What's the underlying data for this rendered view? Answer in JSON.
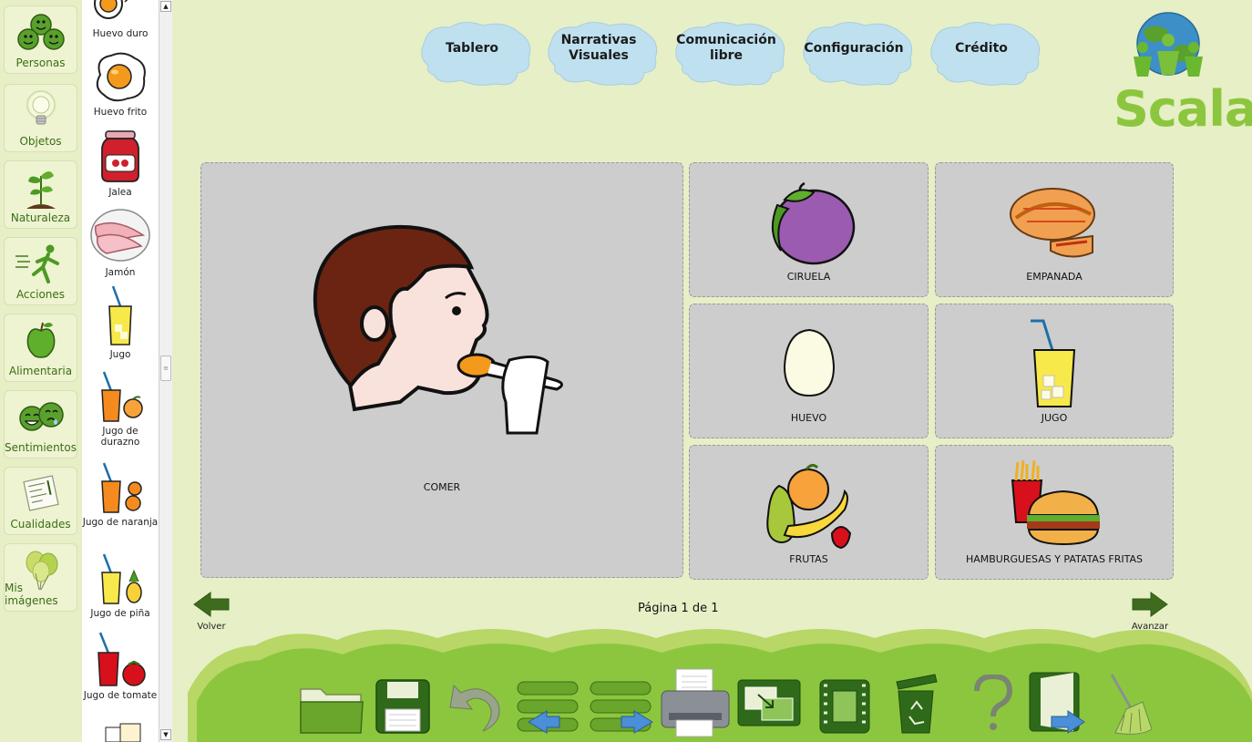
{
  "categories": [
    {
      "label": "Personas",
      "icon": "smileys-icon"
    },
    {
      "label": "Objetos",
      "icon": "lightbulb-icon"
    },
    {
      "label": "Naturaleza",
      "icon": "sprout-icon"
    },
    {
      "label": "Acciones",
      "icon": "running-person-icon"
    },
    {
      "label": "Alimentaria",
      "icon": "apple-icon"
    },
    {
      "label": "Sentimientos",
      "icon": "laughing-faces-icon"
    },
    {
      "label": "Cualidades",
      "icon": "note-paper-icon"
    },
    {
      "label": "Mis imágenes",
      "icon": "balloons-icon"
    }
  ],
  "pictograms": [
    {
      "label": "Huevo duro"
    },
    {
      "label": "Huevo frito"
    },
    {
      "label": "Jalea"
    },
    {
      "label": "Jamón"
    },
    {
      "label": "Jugo"
    },
    {
      "label": "Jugo de durazno"
    },
    {
      "label": "Jugo de naranja"
    },
    {
      "label": "Jugo de piña"
    },
    {
      "label": "Jugo de tomate"
    }
  ],
  "menu": {
    "tablero": "Tablero",
    "narrativas": "Narrativas Visuales",
    "comunicacion": "Comunicación libre",
    "configuracion": "Configuración",
    "credito": "Crédito"
  },
  "logo": {
    "text": "Scala"
  },
  "board": {
    "main": "COMER",
    "cells": [
      "CIRUELA",
      "EMPANADA",
      "HUEVO",
      "JUGO",
      "FRUTAS",
      "HAMBURGUESAS Y PATATAS FRITAS"
    ]
  },
  "pagination": {
    "back": "Volver",
    "forward": "Avanzar",
    "page": "Página 1 de 1"
  },
  "toolbar": [
    "open-folder-icon",
    "save-icon",
    "undo-icon",
    "move-left-icon",
    "move-right-icon",
    "print-icon",
    "export-icon",
    "film-icon",
    "recycle-bin-icon",
    "help-icon",
    "exit-icon",
    "broom-icon"
  ],
  "colors": {
    "background": "#e6efc6",
    "cloud": "#bfe0ef",
    "cell": "#cdcdcd",
    "accent": "#8cc63e"
  }
}
